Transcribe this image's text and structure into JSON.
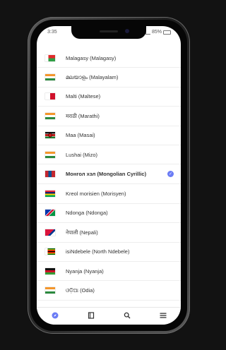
{
  "status_bar": {
    "time": "3:35",
    "battery": "85%"
  },
  "languages": [
    {
      "label": "Malagasy (Malagasy)",
      "flag": "madagascar",
      "selected": false
    },
    {
      "label": "മലയാളം (Malayalam)",
      "flag": "india",
      "selected": false
    },
    {
      "label": "Malti (Maltese)",
      "flag": "malta",
      "selected": false
    },
    {
      "label": "मराठी (Marathi)",
      "flag": "india",
      "selected": false
    },
    {
      "label": "Maa (Masai)",
      "flag": "kenya",
      "selected": false
    },
    {
      "label": "Lushai (Mizo)",
      "flag": "india",
      "selected": false
    },
    {
      "label": "Монгол хэл (Mongolian Cyrillic)",
      "flag": "mongolia",
      "selected": true
    },
    {
      "label": "Kreol morisien (Morisyen)",
      "flag": "mauritius",
      "selected": false
    },
    {
      "label": "Ndonga (Ndonga)",
      "flag": "namibia",
      "selected": false
    },
    {
      "label": "नेपाली (Nepali)",
      "flag": "nepal",
      "selected": false
    },
    {
      "label": "isiNdebele (North Ndebele)",
      "flag": "zimbabwe",
      "selected": false
    },
    {
      "label": "Nyanja (Nyanja)",
      "flag": "malawi",
      "selected": false
    },
    {
      "label": "ଓଡ଼ିଆ (Odia)",
      "flag": "india",
      "selected": false
    }
  ],
  "tabs": [
    {
      "name": "compass-icon",
      "active": true
    },
    {
      "name": "book-icon",
      "active": false
    },
    {
      "name": "search-icon",
      "active": false
    },
    {
      "name": "menu-icon",
      "active": false
    }
  ],
  "colors": {
    "accent": "#6b7cf5",
    "background": "#121212"
  }
}
